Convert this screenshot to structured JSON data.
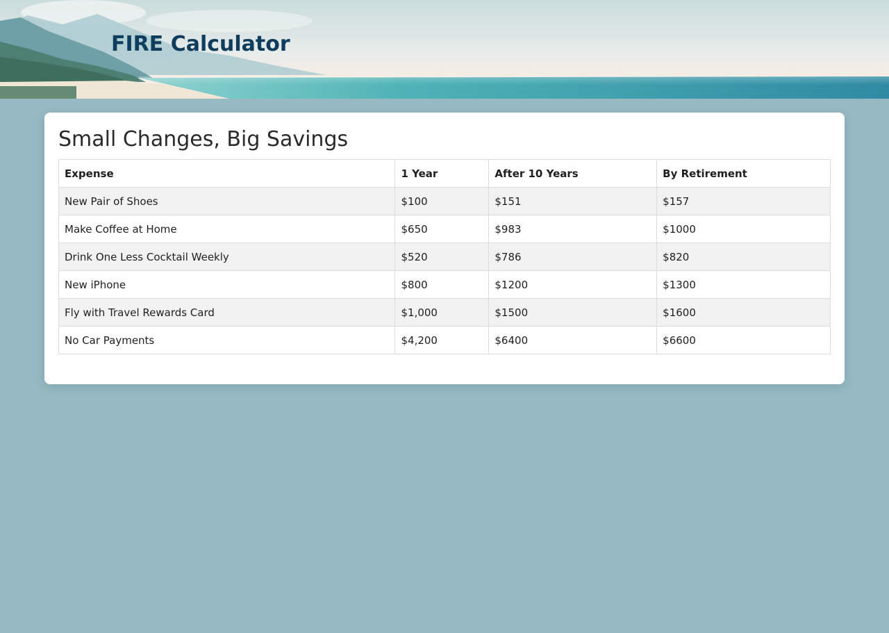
{
  "header": {
    "title": "FIRE Calculator"
  },
  "card": {
    "title": "Small Changes, Big Savings"
  },
  "table": {
    "columns": [
      "Expense",
      "1 Year",
      "After 10 Years",
      "By Retirement"
    ],
    "rows": [
      [
        "New Pair of Shoes",
        "$100",
        "$151",
        "$157"
      ],
      [
        "Make Coffee at Home",
        "$650",
        "$983",
        "$1000"
      ],
      [
        "Drink One Less Cocktail Weekly",
        "$520",
        "$786",
        "$820"
      ],
      [
        "New iPhone",
        "$800",
        "$1200",
        "$1300"
      ],
      [
        "Fly with Travel Rewards Card",
        "$1,000",
        "$1500",
        "$1600"
      ],
      [
        "No Car Payments",
        "$4,200",
        "$6400",
        "$6600"
      ]
    ]
  },
  "colors": {
    "page_background": "#96b9c2",
    "header_title": "#0f3d5e",
    "card_background": "#ffffff",
    "row_stripe": "#f2f2f2"
  }
}
